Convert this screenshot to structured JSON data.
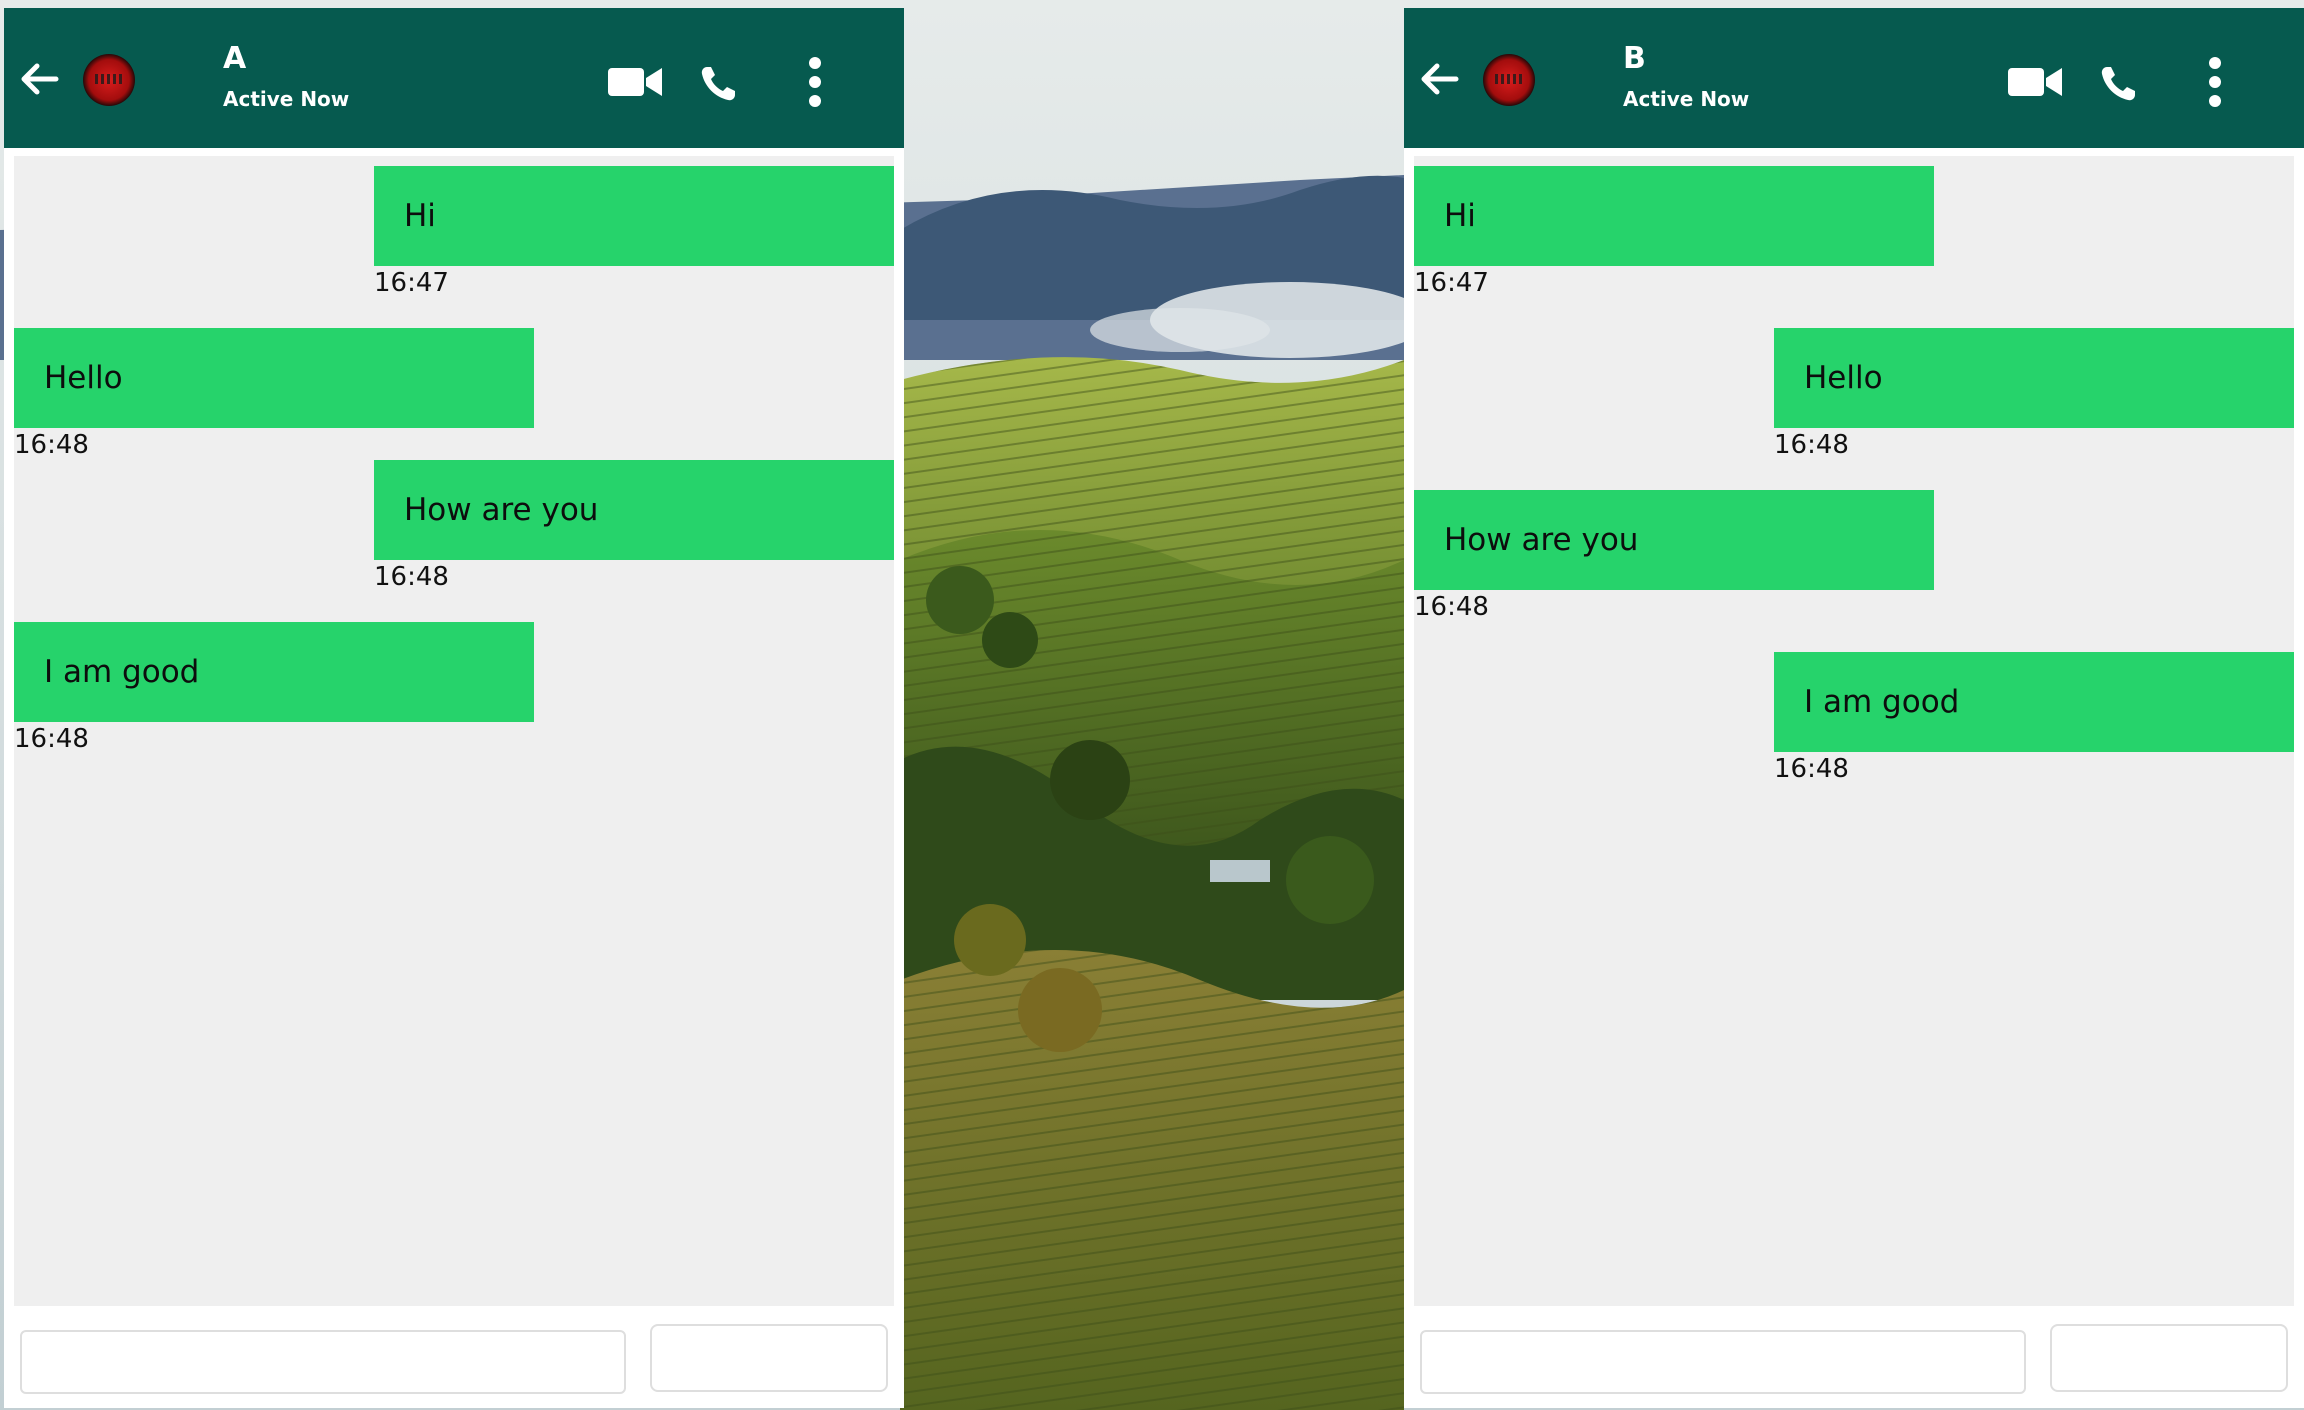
{
  "colors": {
    "header": "#065a4f",
    "bubble": "#26d36b",
    "message_area": "#efefef",
    "header_text": "#ffffff"
  },
  "icons": [
    "back-arrow-icon",
    "video-camera-icon",
    "phone-icon",
    "more-vertical-icon"
  ],
  "chats": [
    {
      "header": {
        "name": "A",
        "status": "Active Now"
      },
      "messages": [
        {
          "text": "Hi",
          "time": "16:47",
          "side": "right"
        },
        {
          "text": "Hello",
          "time": "16:48",
          "side": "left"
        },
        {
          "text": "How are you",
          "time": "16:48",
          "side": "right"
        },
        {
          "text": "I am good",
          "time": "16:48",
          "side": "left"
        }
      ],
      "composer": {
        "input_value": "",
        "send_label": ""
      }
    },
    {
      "header": {
        "name": "B",
        "status": "Active Now"
      },
      "messages": [
        {
          "text": "Hi",
          "time": "16:47",
          "side": "left"
        },
        {
          "text": "Hello",
          "time": "16:48",
          "side": "right"
        },
        {
          "text": "How are you",
          "time": "16:48",
          "side": "left"
        },
        {
          "text": "I am good",
          "time": "16:48",
          "side": "right"
        }
      ],
      "composer": {
        "input_value": "",
        "send_label": ""
      }
    }
  ]
}
